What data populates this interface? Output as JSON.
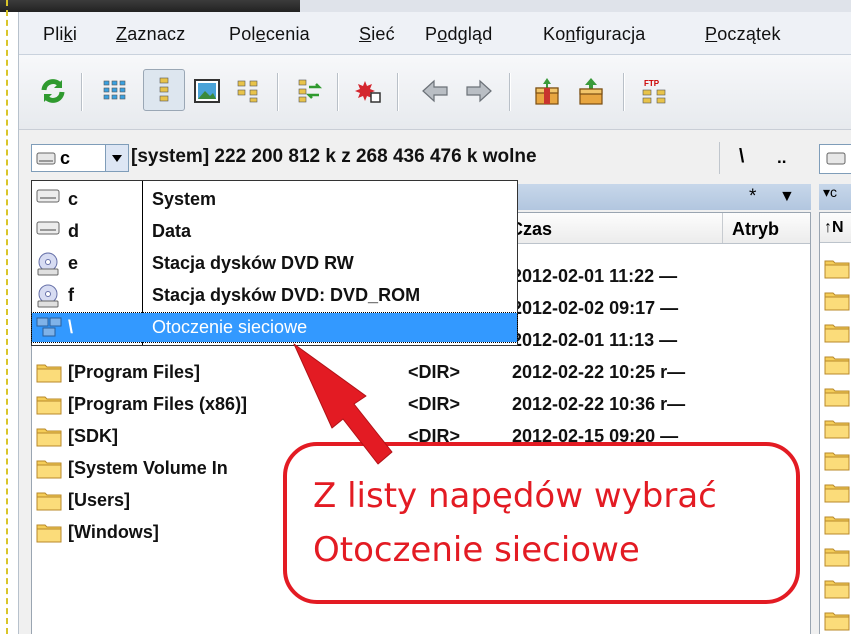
{
  "menu": {
    "items": [
      {
        "pre": "Pli",
        "u": "k",
        "post": "i"
      },
      {
        "pre": "",
        "u": "Z",
        "post": "aznacz"
      },
      {
        "pre": "Pol",
        "u": "e",
        "post": "cenia"
      },
      {
        "pre": "",
        "u": "S",
        "post": "ieć"
      },
      {
        "pre": "P",
        "u": "o",
        "post": "dgląd"
      },
      {
        "pre": "Ko",
        "u": "n",
        "post": "figuracja"
      },
      {
        "pre": "",
        "u": "P",
        "post": "oczątek"
      }
    ]
  },
  "toolbar": {
    "icons": [
      "refresh-icon",
      "brief-view-icon",
      "full-view-icon",
      "thumbnail-view-icon",
      "tree-view-icon",
      "sync-dirs-icon",
      "pack-icon",
      "back-icon",
      "forward-icon",
      "archive-icon",
      "unpack-icon",
      "ftp-icon"
    ]
  },
  "drivebar": {
    "current_drive": "c",
    "info": "[system]  222 200 812 k z 268 436 476 k wolne",
    "root_btn": "\\",
    "up_btn": ".."
  },
  "pathstrip": {
    "star": "*",
    "right_label": "▾c"
  },
  "columns": {
    "time": "Czas",
    "attr": "Atryb"
  },
  "right_header": "↑N",
  "dropdown": {
    "items": [
      {
        "letter": "c",
        "label": "System",
        "icon": "hard-drive-icon"
      },
      {
        "letter": "d",
        "label": "Data",
        "icon": "hard-drive-icon"
      },
      {
        "letter": "e",
        "label": "Stacja dysków DVD RW",
        "icon": "dvd-drive-icon"
      },
      {
        "letter": "f",
        "label": "Stacja dysków DVD: DVD_ROM",
        "icon": "dvd-drive-icon"
      },
      {
        "letter": "\\",
        "label": "Otoczenie sieciowe",
        "icon": "network-icon"
      }
    ],
    "selected_index": 4
  },
  "files": [
    {
      "name": "",
      "size": "",
      "time": "2012-02-01 11:22",
      "attr": "—"
    },
    {
      "name": "",
      "size": "",
      "time": "2012-02-02 09:17",
      "attr": "—"
    },
    {
      "name": "",
      "size": "",
      "time": "2012-02-01 11:13",
      "attr": "—"
    },
    {
      "name": "[Program Files]",
      "size": "<DIR>",
      "time": "2012-02-22 10:25",
      "attr": "r—"
    },
    {
      "name": "[Program Files (x86)]",
      "size": "<DIR>",
      "time": "2012-02-22 10:36",
      "attr": "r—"
    },
    {
      "name": "[SDK]",
      "size": "<DIR>",
      "time": "2012-02-15 09:20",
      "attr": "—"
    },
    {
      "name": "[System Volume In",
      "size": "",
      "time": "",
      "attr": ""
    },
    {
      "name": "[Users]",
      "size": "",
      "time": "",
      "attr": ""
    },
    {
      "name": "[Windows]",
      "size": "",
      "time": "",
      "attr": ""
    }
  ],
  "annotation": {
    "line1": "Z listy napędów wybrać",
    "line2": "Otoczenie sieciowe",
    "color": "#e31b23"
  }
}
